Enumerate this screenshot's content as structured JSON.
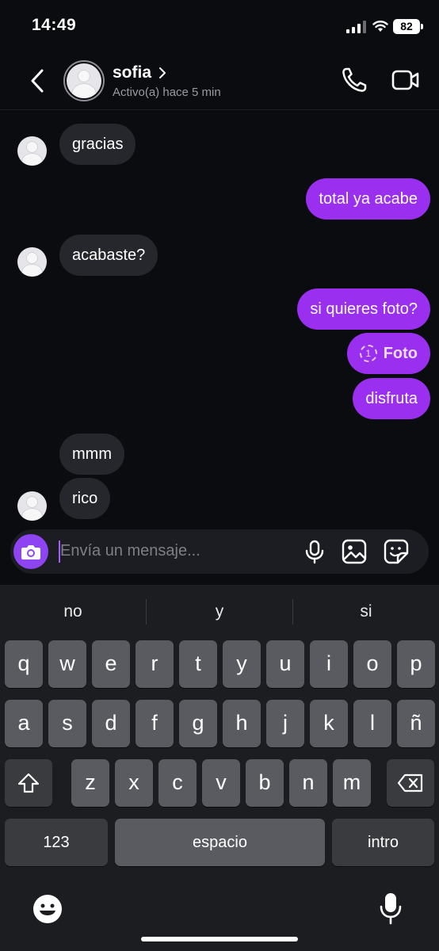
{
  "status_bar": {
    "time": "14:49",
    "battery": "82"
  },
  "header": {
    "contact_name": "sofia",
    "presence": "Activo(a) hace 5 min"
  },
  "messages": [
    {
      "side": "received",
      "text": "gracias"
    },
    {
      "side": "sent",
      "text": "total ya acabe"
    },
    {
      "side": "received",
      "text": "acabaste?"
    },
    {
      "side": "sent",
      "text": "si quieres foto?"
    },
    {
      "side": "sent",
      "text": "Foto",
      "type": "view-once-photo",
      "badge": "1"
    },
    {
      "side": "sent",
      "text": "disfruta"
    },
    {
      "side": "received",
      "text": "mmm"
    },
    {
      "side": "received",
      "text": "rico"
    }
  ],
  "composer": {
    "placeholder": "Envía un mensaje..."
  },
  "keyboard": {
    "suggestions": [
      "no",
      "y",
      "si"
    ],
    "row1": [
      "q",
      "w",
      "e",
      "r",
      "t",
      "y",
      "u",
      "i",
      "o",
      "p"
    ],
    "row2": [
      "a",
      "s",
      "d",
      "f",
      "g",
      "h",
      "j",
      "k",
      "l",
      "ñ"
    ],
    "row3": [
      "z",
      "x",
      "c",
      "v",
      "b",
      "n",
      "m"
    ],
    "numbers_key": "123",
    "space_key": "espacio",
    "return_key": "intro"
  },
  "colors": {
    "sent_bubble": "#9a2ff0",
    "received_bubble": "#26272c",
    "accent": "#8e44f2",
    "background": "#0b0c10"
  }
}
